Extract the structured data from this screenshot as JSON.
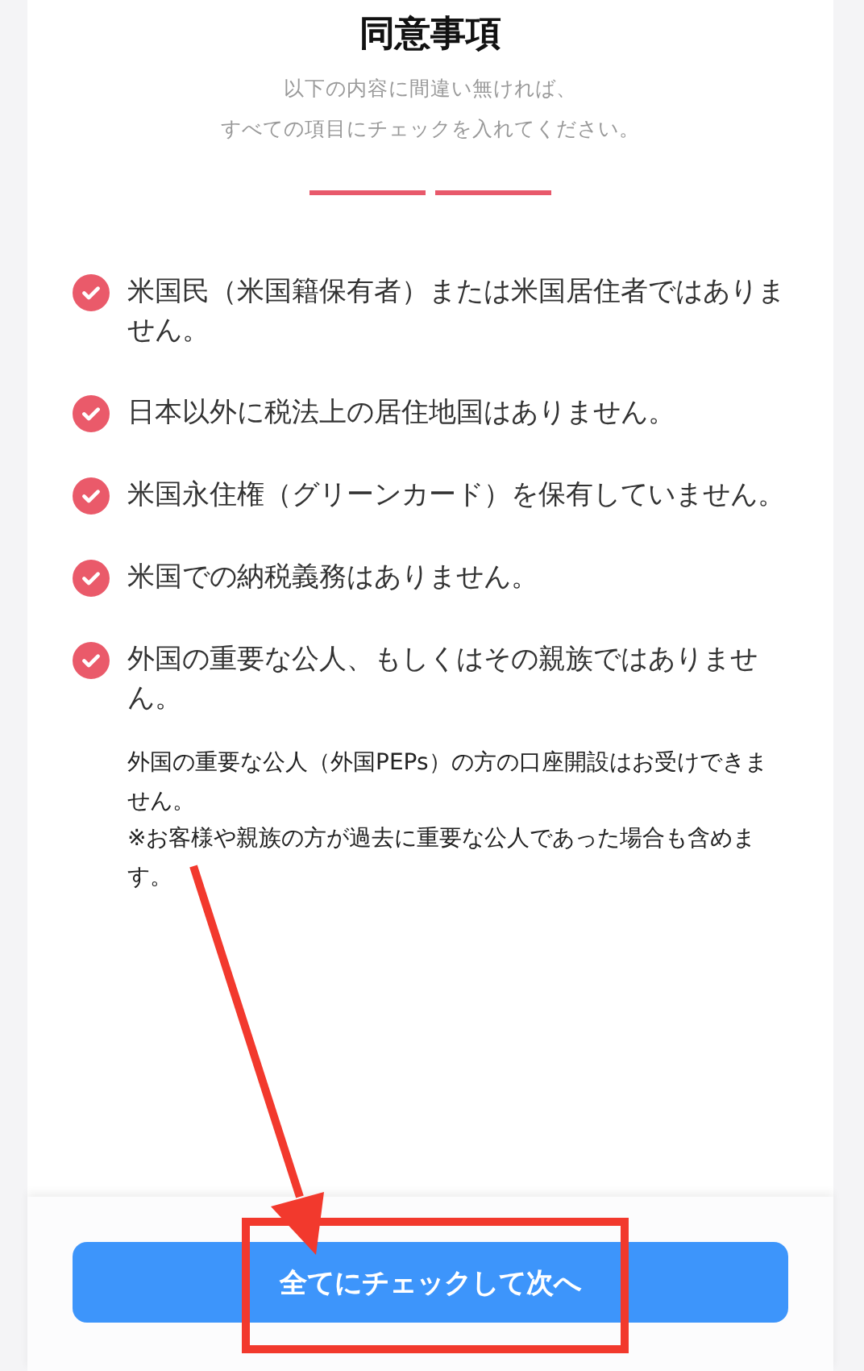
{
  "title": "同意事項",
  "subtitle": [
    "以下の内容に間違い無ければ、",
    "すべての項目にチェックを入れてください。"
  ],
  "progress_steps": [
    {
      "done": true
    },
    {
      "done": true
    }
  ],
  "items": [
    {
      "text": "米国民（米国籍保有者）または米国居住者ではありません。",
      "checked": true
    },
    {
      "text": "日本以外に税法上の居住地国はありません。",
      "checked": true
    },
    {
      "text": "米国永住権（グリーンカード）を保有していません。",
      "checked": true
    },
    {
      "text": "米国での納税義務はありません。",
      "checked": true
    },
    {
      "text": "外国の重要な公人、もしくはその親族ではありません。",
      "checked": true
    }
  ],
  "note": [
    "外国の重要な公人（外国PEPs）の方の口座開設はお受けできません。",
    "※お客様や親族の方が過去に重要な公人であった場合も含めます。"
  ],
  "button": "全てにチェックして次へ"
}
